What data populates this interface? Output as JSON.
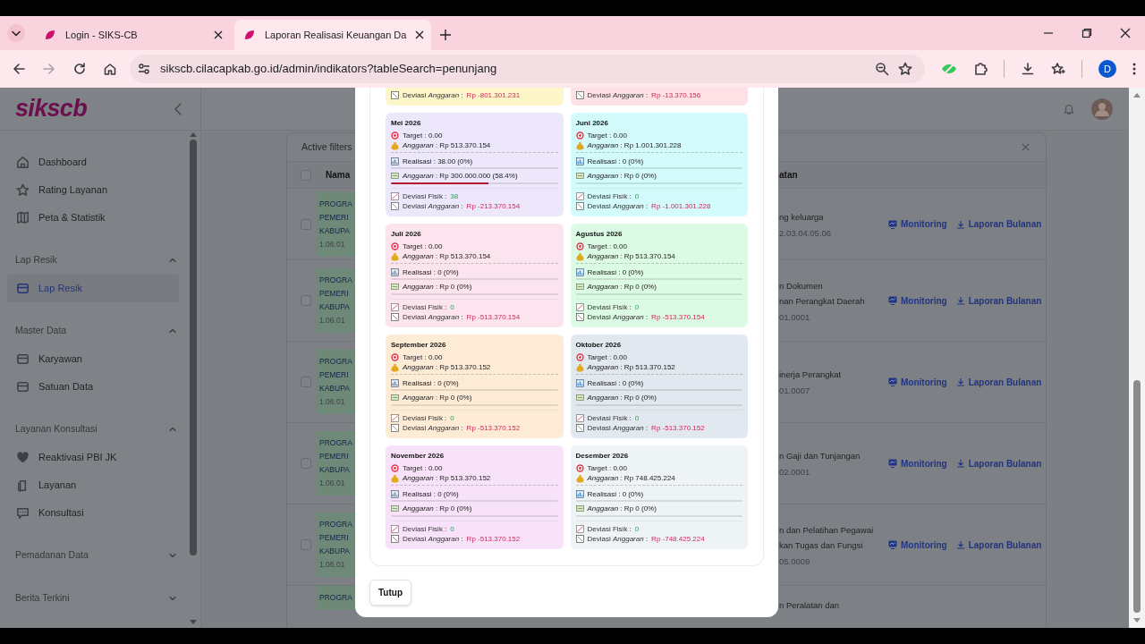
{
  "browser": {
    "tabs": [
      {
        "title": "Login - SIKS-CB",
        "selected": false
      },
      {
        "title": "Laporan Realisasi Keuangan Da",
        "selected": true
      }
    ],
    "url": "sikscb.cilacapkab.go.id/admin/indikators?tableSearch=penunjang",
    "profile": "D"
  },
  "sidebar": {
    "logo": "sikscb",
    "items": [
      {
        "label": "Dashboard",
        "selected": false
      },
      {
        "label": "Rating Layanan",
        "selected": false
      },
      {
        "label": "Peta & Statistik",
        "selected": false
      }
    ],
    "groups": [
      {
        "label": "Lap Resik",
        "expanded": true,
        "items": [
          {
            "label": "Lap Resik",
            "selected": true
          }
        ]
      },
      {
        "label": "Master Data",
        "expanded": true,
        "items": [
          {
            "label": "Karyawan",
            "selected": false
          },
          {
            "label": "Satuan Data",
            "selected": false
          }
        ]
      },
      {
        "label": "Layanan Konsultasi",
        "expanded": true,
        "items": [
          {
            "label": "Reaktivasi PBI JK",
            "selected": false
          },
          {
            "label": "Layanan",
            "selected": false
          },
          {
            "label": "Konsultasi",
            "selected": false
          }
        ]
      },
      {
        "label": "Pemadanan Data",
        "expanded": false
      },
      {
        "label": "Berita Terkini",
        "expanded": false
      }
    ]
  },
  "table": {
    "filters_label": "Active filters",
    "select_all_checked": false,
    "columns": [
      "Nama",
      "atan"
    ],
    "rows": [
      {
        "checked": false,
        "name_lines": [
          "PROGRA",
          "PEMERI",
          "KABUPA"
        ],
        "code": "1.06.01",
        "desc_lines": [
          "ng keluarga"
        ],
        "desc_code": "2.03.04.05.06",
        "actions": [
          "Monitoring",
          "Laporan Bulanan"
        ]
      },
      {
        "checked": false,
        "name_lines": [
          "PROGRA",
          "PEMERI",
          "KABUPA"
        ],
        "code": "1.06.01",
        "desc_lines": [
          "n Dokumen",
          "nan Perangkat Daerah"
        ],
        "desc_code": "01.0001",
        "actions": [
          "Monitoring",
          "Laporan Bulanan"
        ]
      },
      {
        "checked": false,
        "name_lines": [
          "PROGRA",
          "PEMERI",
          "KABUPA"
        ],
        "code": "1.06.01",
        "desc_lines": [
          "inerja Perangkat"
        ],
        "desc_code": "01.0007",
        "actions": [
          "Monitoring",
          "Laporan Bulanan"
        ]
      },
      {
        "checked": false,
        "name_lines": [
          "PROGRA",
          "PEMERI",
          "KABUPA"
        ],
        "code": "1.06.01",
        "desc_lines": [
          "n Gaji dan Tunjangan"
        ],
        "desc_code": "02.0001",
        "actions": [
          "Monitoring",
          "Laporan Bulanan"
        ]
      },
      {
        "checked": false,
        "name_lines": [
          "PROGRA",
          "PEMERI",
          "KABUPA"
        ],
        "code": "1.06.01",
        "desc_lines": [
          "n dan Pelatihan Pegawai",
          "kan Tugas dan Fungsi"
        ],
        "desc_code": "05.0009",
        "actions": [
          "Monitoring",
          "Laporan Bulanan"
        ]
      },
      {
        "name_lines": [
          "PROGRA"
        ],
        "desc_lines": [
          "n Peralatan dan"
        ]
      }
    ]
  },
  "modal": {
    "partial_cards": [
      {
        "color": "#fdf6c9",
        "dev_label": "Deviasi *Anggaran* :",
        "dev_value": "Rp -801.301.231"
      },
      {
        "color": "#fde1e4",
        "dev_label": "Deviasi *Anggaran* :",
        "dev_value": "Rp -13.370.156"
      }
    ],
    "cards": [
      {
        "title": "Mei 2026",
        "color": "#ece7fb",
        "target": "Target : 0.00",
        "anggaran": "*Anggaran* : Rp 513.370.154",
        "realisasi": {
          "text": "Realisasi : 38.00 (0%)",
          "level": 0
        },
        "serapan": {
          "text": "*Anggaran* : Rp 300.000.000 (58.4%)",
          "level": 0.584
        },
        "fisik_label": "Deviasi Fisik :",
        "fisik_value": "38",
        "dev_label": "Deviasi *Anggaran* :",
        "dev_value": "Rp -213.370.154"
      },
      {
        "title": "Juni 2026",
        "color": "#d3fbfb",
        "target": "Target : 0.00",
        "anggaran": "*Anggaran* : Rp 1.001.301.228",
        "realisasi": {
          "text": "Realisasi : 0 (0%)",
          "level": 0
        },
        "serapan": {
          "text": "*Anggaran* : Rp 0 (0%)",
          "level": 0
        },
        "fisik_label": "Deviasi Fisik :",
        "fisik_value": "0",
        "dev_label": "Deviasi *Anggaran* :",
        "dev_value": "Rp -1.001.301.228"
      },
      {
        "title": "Juli 2026",
        "color": "#fce4ee",
        "target": "Target : 0.00",
        "anggaran": "*Anggaran* : Rp 513.370.154",
        "realisasi": {
          "text": "Realisasi : 0 (0%)",
          "level": 0
        },
        "serapan": {
          "text": "*Anggaran* : Rp 0 (0%)",
          "level": 0
        },
        "fisik_label": "Deviasi Fisik :",
        "fisik_value": "0",
        "dev_label": "Deviasi *Anggaran* :",
        "dev_value": "Rp -513.370.154"
      },
      {
        "title": "Agustus 2026",
        "color": "#dcfbe4",
        "target": "Target : 0.00",
        "anggaran": "*Anggaran* : Rp 513.370.154",
        "realisasi": {
          "text": "Realisasi : 0 (0%)",
          "level": 0
        },
        "serapan": {
          "text": "*Anggaran* : Rp 0 (0%)",
          "level": 0
        },
        "fisik_label": "Deviasi Fisik :",
        "fisik_value": "0",
        "dev_label": "Deviasi *Anggaran* :",
        "dev_value": "Rp -513.370.154"
      },
      {
        "title": "September 2026",
        "color": "#fdebd6",
        "target": "Target : 0.00",
        "anggaran": "*Anggaran* : Rp 513.370.152",
        "realisasi": {
          "text": "Realisasi : 0 (0%)",
          "level": 0
        },
        "serapan": {
          "text": "*Anggaran* : Rp 0 (0%)",
          "level": 0
        },
        "fisik_label": "Deviasi Fisik :",
        "fisik_value": "0",
        "dev_label": "Deviasi *Anggaran* :",
        "dev_value": "Rp -513.370.152"
      },
      {
        "title": "Oktober 2026",
        "color": "#e2e8ef",
        "target": "Target : 0.00",
        "anggaran": "*Anggaran* : Rp 513.370.152",
        "realisasi": {
          "text": "Realisasi : 0 (0%)",
          "level": 0
        },
        "serapan": {
          "text": "*Anggaran* : Rp 0 (0%)",
          "level": 0
        },
        "fisik_label": "Deviasi Fisik :",
        "fisik_value": "0",
        "dev_label": "Deviasi *Anggaran* :",
        "dev_value": "Rp -513.370.152"
      },
      {
        "title": "November 2026",
        "color": "#f7e2f9",
        "target": "Target : 0.00",
        "anggaran": "*Anggaran* : Rp 513.370.152",
        "realisasi": {
          "text": "Realisasi : 0 (0%)",
          "level": 0
        },
        "serapan": {
          "text": "*Anggaran* : Rp 0 (0%)",
          "level": 0
        },
        "fisik_label": "Deviasi Fisik :",
        "fisik_value": "0",
        "dev_label": "Deviasi *Anggaran* :",
        "dev_value": "Rp -513.370.152"
      },
      {
        "title": "Desember 2026",
        "color": "#eef3f6",
        "target": "Target : 0.00",
        "anggaran": "*Anggaran* : Rp 748.425.224",
        "realisasi": {
          "text": "Realisasi : 0 (0%)",
          "level": 0
        },
        "serapan": {
          "text": "*Anggaran* : Rp 0 (0%)",
          "level": 0
        },
        "fisik_label": "Deviasi Fisik :",
        "fisik_value": "0",
        "dev_label": "Deviasi *Anggaran* :",
        "dev_value": "Rp -748.425.224"
      }
    ],
    "close_button": "Tutup"
  }
}
